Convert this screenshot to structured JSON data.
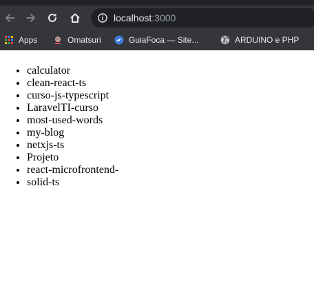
{
  "browser": {
    "url_host": "localhost",
    "url_port": ":3000"
  },
  "bookmarks": [
    {
      "label": "Apps",
      "icon": "apps-grid-icon"
    },
    {
      "label": "Omatsuri",
      "icon": "omatsuri-icon"
    },
    {
      "label": "GuiaFoca — Site...",
      "icon": "guiafoca-icon"
    },
    {
      "label": "ARDUINO e PHP",
      "icon": "globe-icon"
    }
  ],
  "projects": [
    "calculator",
    "clean-react-ts",
    "curso-js-typescript",
    "LaravelTI-curso",
    "most-used-words",
    "my-blog",
    "netxjs-ts",
    "Projeto",
    "react-microfrontend-",
    "solid-ts"
  ]
}
